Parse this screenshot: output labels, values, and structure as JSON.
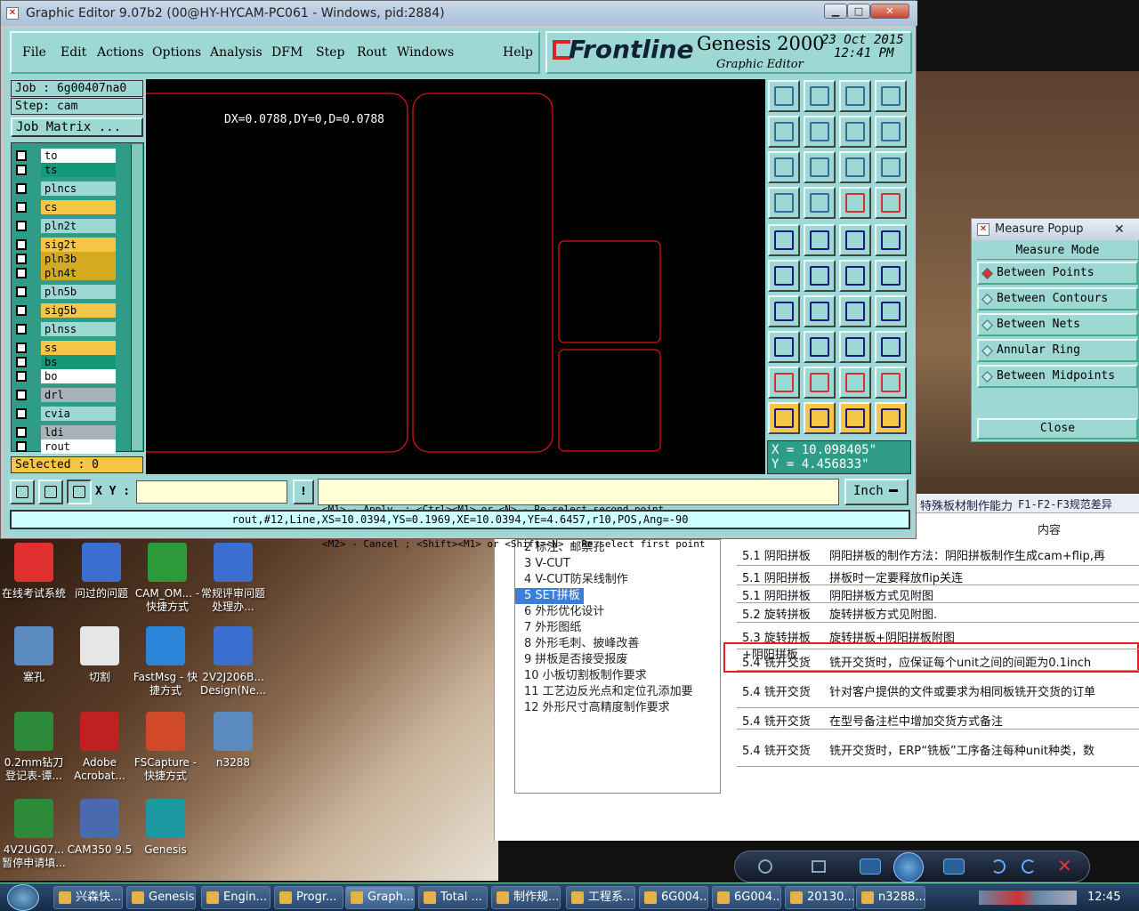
{
  "editor": {
    "title": "Graphic Editor 9.07b2 (00@HY-HYCAM-PC061 - Windows, pid:2884)",
    "menus": [
      "File",
      "Edit",
      "Actions",
      "Options",
      "Analysis",
      "DFM",
      "Step",
      "Rout",
      "Windows",
      "Help"
    ],
    "brand": "Frontline",
    "product": "Genesis 2000",
    "subtitle": "Graphic Editor",
    "date": "23 Oct 2015",
    "time": "12:41 PM",
    "job": "Job : 6g00407na0",
    "step": "Step: cam",
    "job_matrix": "Job Matrix ...",
    "selected": "Selected : 0",
    "measure_text": "DX=0.0788,DY=0,D=0.0788",
    "coord_x": "X = 10.098405\"",
    "coord_y": "Y = 4.456833\"",
    "xy_label": "X Y :",
    "xy_value": "",
    "hint1": "<M1> - Apply  ; <Ctrl><M1> or <N> - Re-select second point",
    "hint2": "<M2> - Cancel ; <Shift><M1> or <Shift><N> - Re-select first point",
    "units": "Inch",
    "status": "rout,#12,Line,XS=10.0394,YS=0.1969,XE=10.0394,YE=4.6457,r10,POS,Ang=-90",
    "layers": [
      {
        "name": "to",
        "color": "#ffffff"
      },
      {
        "name": "ts",
        "color": "#129a78"
      },
      {
        "name": "plncs",
        "color": "#9ed8d4"
      },
      {
        "name": "cs",
        "color": "#f5c646"
      },
      {
        "name": "pln2t",
        "color": "#9ed8d4"
      },
      {
        "name": "sig2t",
        "color": "#f5c646"
      },
      {
        "name": "pln3b",
        "color": "#d4aa20"
      },
      {
        "name": "pln4t",
        "color": "#d4aa20"
      },
      {
        "name": "pln5b",
        "color": "#9ed8d4"
      },
      {
        "name": "sig5b",
        "color": "#f5c646"
      },
      {
        "name": "plnss",
        "color": "#9ed8d4"
      },
      {
        "name": "ss",
        "color": "#f5c646"
      },
      {
        "name": "bs",
        "color": "#129a78"
      },
      {
        "name": "bo",
        "color": "#ffffff"
      },
      {
        "name": "drl",
        "color": "#a7b3b8"
      },
      {
        "name": "cvia",
        "color": "#9ed8d4"
      },
      {
        "name": "ldi",
        "color": "#a7b3b8"
      },
      {
        "name": "rout",
        "color": "#ffffff"
      }
    ]
  },
  "measure_popup": {
    "title": "Measure Popup",
    "mode_label": "Measure Mode",
    "options": [
      "Between Points",
      "Between Contours",
      "Between Nets",
      "Annular Ring",
      "Between Midpoints"
    ],
    "selected": "Between Points",
    "close": "Close"
  },
  "doc": {
    "tab1": "特殊板材制作能力",
    "tab2": "F1-F2-F3规范差异",
    "col_header": "内容",
    "toc": [
      "2 标注、邮票孔",
      "3 V-CUT",
      "4 V-CUT防呆线制作",
      "5 SET拼板",
      "6 外形优化设计",
      "7 外形图纸",
      "8 外形毛刺、披峰改善",
      "9 拼板是否接受报废",
      "10 小板切割板制作要求",
      "11 工艺边反光点和定位孔添加要",
      "12 外形尺寸高精度制作要求"
    ],
    "rows": [
      {
        "sec": "5.1 阴阳拼板",
        "text": "阴阳拼板的制作方法：阴阳拼板制作生成cam+flip,再"
      },
      {
        "sec": "5.1 阴阳拼板",
        "text": "拼板时一定要释放flip关连"
      },
      {
        "sec": "5.1 阴阳拼板",
        "text": "阴阳拼板方式见附图"
      },
      {
        "sec": "5.2 旋转拼板",
        "text": "旋转拼板方式见附图."
      },
      {
        "sec": "5.3 旋转拼板+阴阳拼板",
        "text": "旋转拼板+阴阳拼板附图"
      },
      {
        "sec": "5.4 铣开交货",
        "text": "铣开交货时，应保证每个unit之间的间距为0.1inch"
      },
      {
        "sec": "5.4 铣开交货",
        "text": "针对客户提供的文件或要求为相同板铣开交货的订单"
      },
      {
        "sec": "5.4 铣开交货",
        "text": "在型号备注栏中增加交货方式备注"
      },
      {
        "sec": "5.4 铣开交货",
        "text": "铣开交货时，ERP“铣板”工序备注每种unit种类，数"
      }
    ]
  },
  "desktop_icons": [
    {
      "label": "在线考试系统",
      "color": "#e03030"
    },
    {
      "label": "问过的问题",
      "color": "#3a6fd0"
    },
    {
      "label": "CAM_OM... - 快捷方式",
      "color": "#2d9a3a"
    },
    {
      "label": "常规评审问题处理办...",
      "color": "#3a6fd0"
    },
    {
      "label": "塞孔",
      "color": "#5a8abf"
    },
    {
      "label": "切割",
      "color": "#e6e6e6"
    },
    {
      "label": "FastMsg - 快捷方式",
      "color": "#2a84d8"
    },
    {
      "label": "2V2J206B... Design(Ne...",
      "color": "#3a6fd0"
    },
    {
      "label": "0.2mm钻刀登记表-谭...",
      "color": "#2d8a3a"
    },
    {
      "label": "Adobe Acrobat...",
      "color": "#c02020"
    },
    {
      "label": "FSCapture - 快捷方式",
      "color": "#d04a2a"
    },
    {
      "label": "n3288",
      "color": "#5a8abf"
    },
    {
      "label": "4V2UG07... 暂停申请填...",
      "color": "#2d8a3a"
    },
    {
      "label": "CAM350 9.5",
      "color": "#4a6ab0"
    },
    {
      "label": "Genesis",
      "color": "#1a9aa0"
    }
  ],
  "taskbar": {
    "items": [
      "兴森快...",
      "Genesis",
      "Engin...",
      "Progr...",
      "Graph...",
      "Total ...",
      "制作规...",
      "工程系...",
      "6G004...",
      "6G004...",
      "20130...",
      "n3288..."
    ],
    "clock": "12:45"
  }
}
